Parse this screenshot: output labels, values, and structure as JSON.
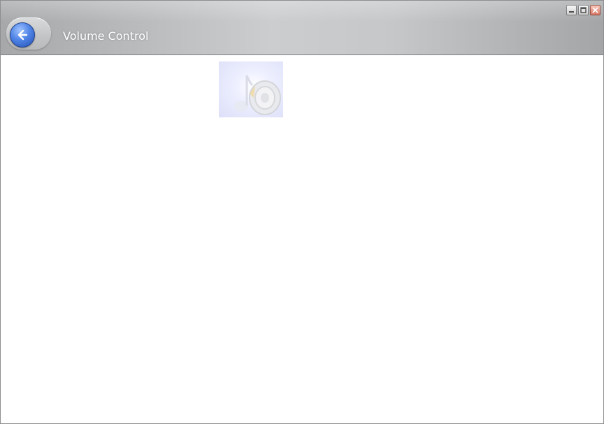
{
  "window": {
    "title": "Volume Control"
  },
  "caption_buttons": {
    "minimize_icon": "minimize-icon",
    "maximize_icon": "maximize-icon",
    "close_icon": "close-icon"
  },
  "navigation": {
    "back_icon": "back-arrow-icon"
  },
  "content": {
    "speaker_icon": "speaker-music-note-icon"
  },
  "colors": {
    "titlebar": "#c5c7c9",
    "back_button": "#3f72d8",
    "close_button": "#d46a55",
    "background": "#ffffff"
  }
}
